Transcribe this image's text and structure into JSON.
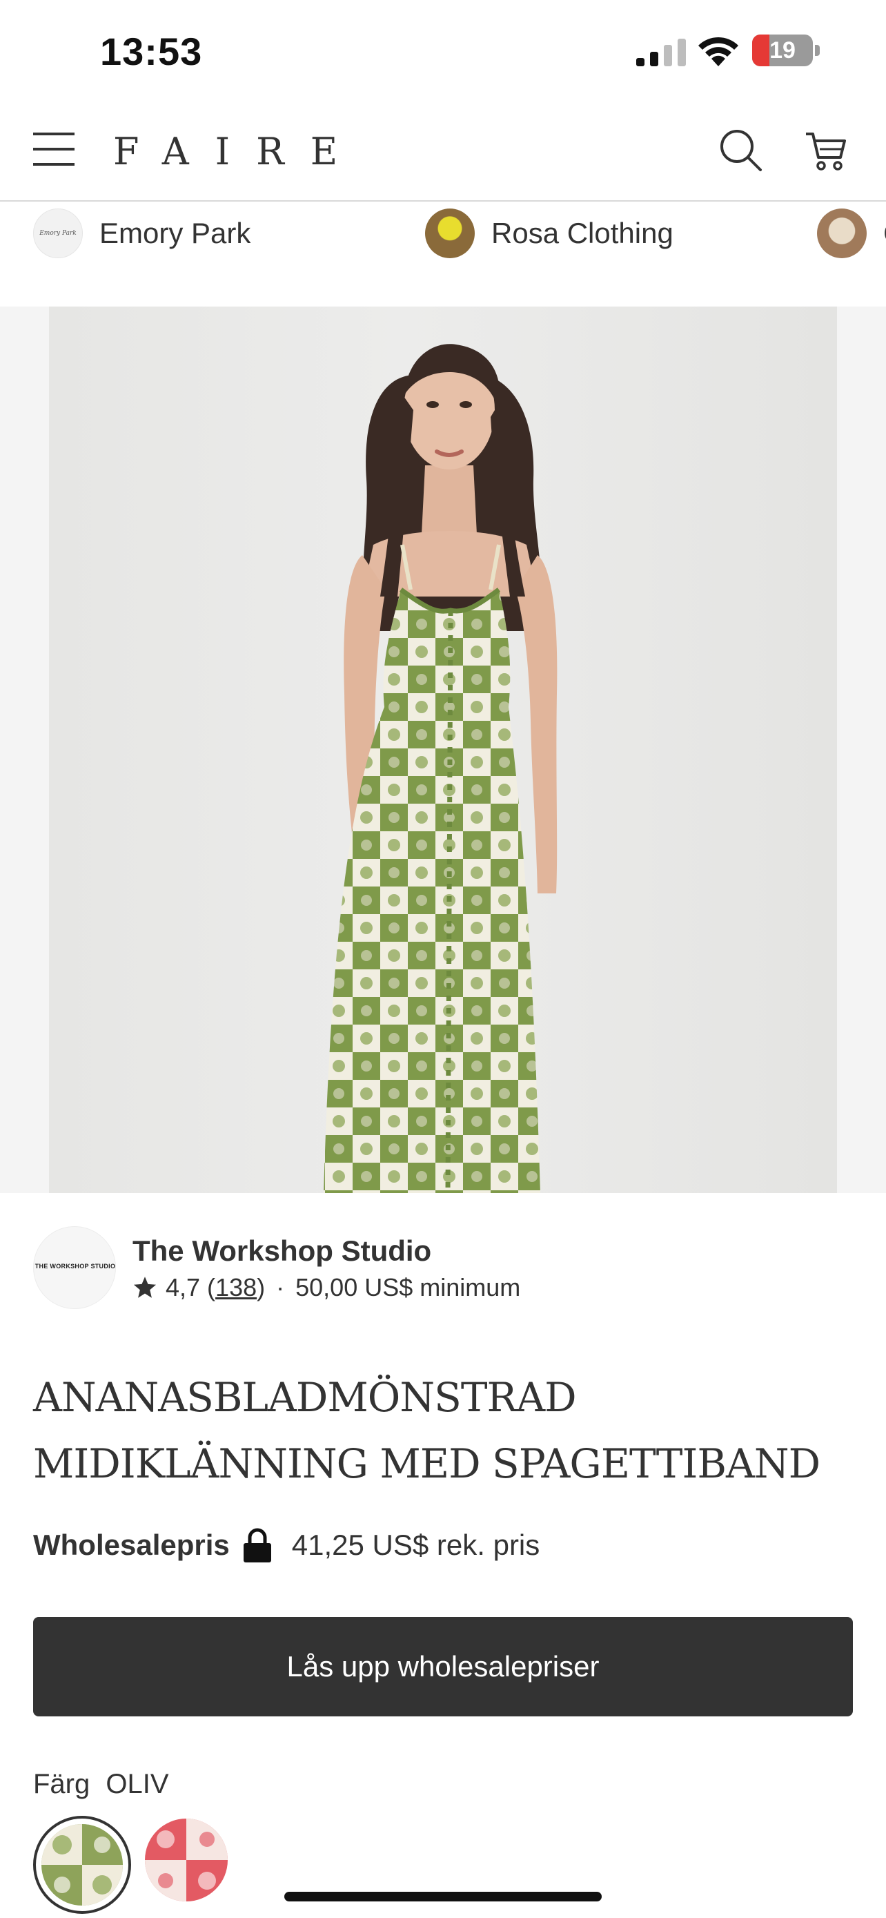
{
  "status_bar": {
    "time": "13:53",
    "battery_level": "19",
    "icons": [
      "signal-icon",
      "wifi-icon",
      "battery-charging-icon"
    ]
  },
  "header": {
    "logo": "FAIRE",
    "icons": [
      "hamburger-menu-icon",
      "search-icon",
      "cart-icon"
    ]
  },
  "brands": [
    {
      "name": "Emory Park",
      "avatar_text": "Emory Park"
    },
    {
      "name": "Rosa Clothing"
    },
    {
      "name": "C"
    }
  ],
  "product_image": {
    "dress_color": "#7f9a4a",
    "dress_light": "#f2efe3",
    "background": "#e8e8e6"
  },
  "shop": {
    "logo_text": "THE WORKSHOP STUDIO",
    "name": "The Workshop Studio",
    "rating": "4,7",
    "review_count": "138",
    "separator": "·",
    "minimum": "50,00 US$ minimum"
  },
  "product": {
    "title": "ANANASBLADMÖNSTRAD MIDIKLÄNNING MED SPAGETTIBAND"
  },
  "price": {
    "wholesale_label": "Wholesalepris",
    "retail_price": "41,25 US$ rek. pris"
  },
  "cta": {
    "unlock_label": "Lås upp wholesalepriser"
  },
  "color": {
    "label": "Färg",
    "selected_value": "OLIV",
    "swatches": [
      {
        "name": "OLIV",
        "color": "#8ea35a"
      },
      {
        "name": "RED",
        "color": "#e35a63"
      }
    ]
  },
  "colors": {
    "text": "#333333",
    "button": "#333333",
    "battery_red": "#e53935"
  }
}
